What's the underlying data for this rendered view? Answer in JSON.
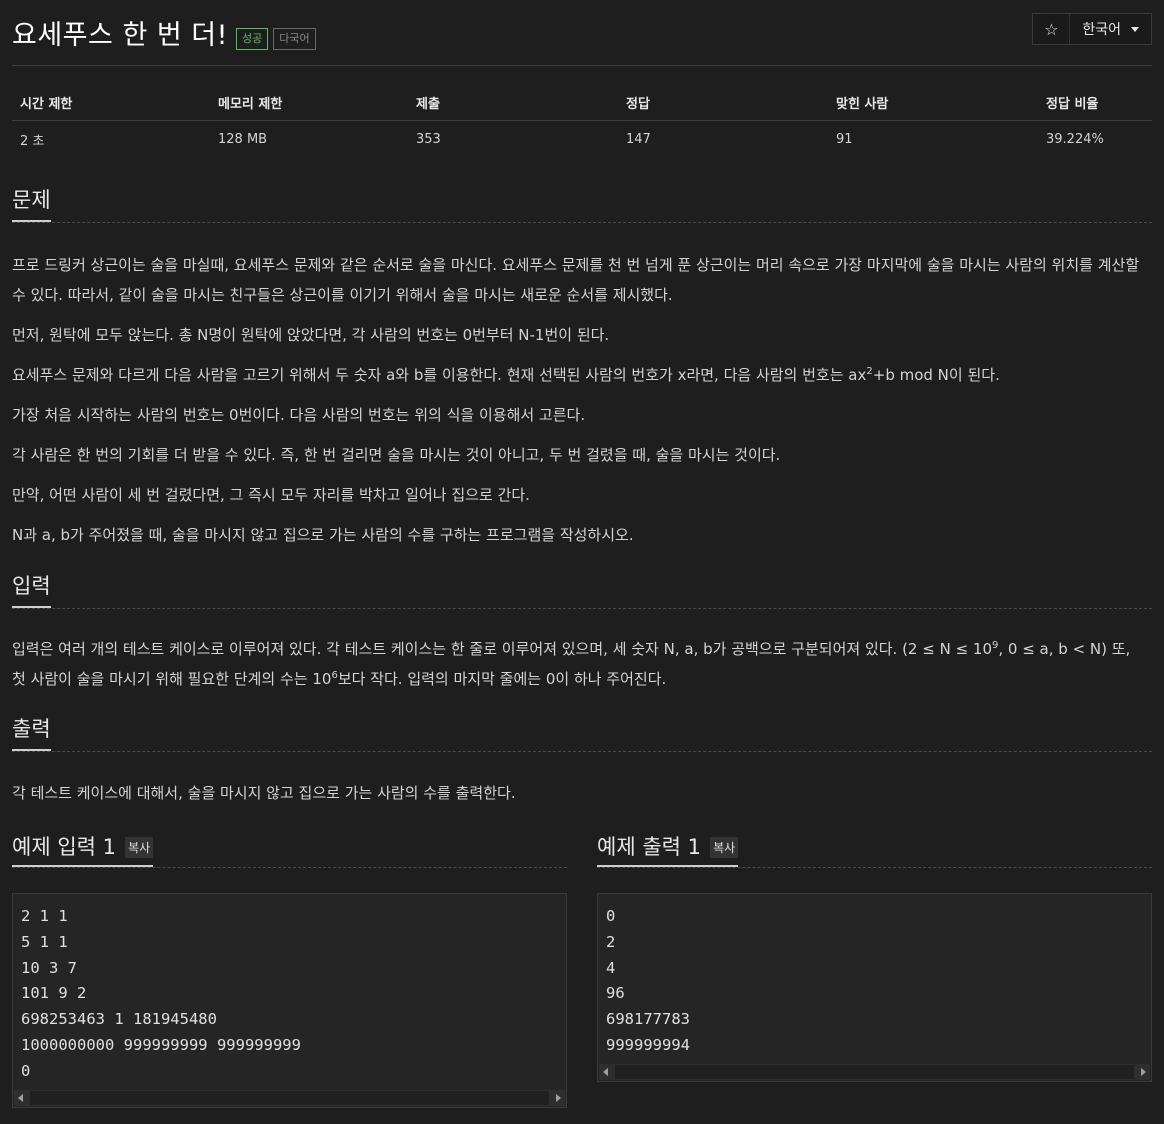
{
  "header": {
    "title": "요세푸스 한 번 더!",
    "badge_success": "성공",
    "badge_multilang": "다국어",
    "star_icon": "star-icon",
    "language": "한국어"
  },
  "info_table": {
    "headers": [
      "시간 제한",
      "메모리 제한",
      "제출",
      "정답",
      "맞힌 사람",
      "정답 비율"
    ],
    "values": [
      "2 초",
      "128 MB",
      "353",
      "147",
      "91",
      "39.224%"
    ]
  },
  "problem": {
    "heading": "문제",
    "paragraphs": [
      "프로 드링커 상근이는 술을 마실때, 요세푸스 문제와 같은 순서로 술을 마신다. 요세푸스 문제를 천 번 넘게 푼 상근이는 머리 속으로 가장 마지막에 술을 마시는 사람의 위치를 계산할 수 있다. 따라서, 같이 술을 마시는 친구들은 상근이를 이기기 위해서 술을 마시는 새로운 순서를 제시했다.",
      "먼저, 원탁에 모두 앉는다. 총 N명이 원탁에 앉았다면, 각 사람의 번호는 0번부터 N-1번이 된다.",
      "요세푸스 문제와 다르게 다음 사람을 고르기 위해서 두 숫자 a와 b를 이용한다. 현재 선택된 사람의 번호가 x라면, 다음 사람의 번호는 ax",
      "가장 처음 시작하는 사람의 번호는 0번이다. 다음 사람의 번호는 위의 식을 이용해서 고른다.",
      "각 사람은 한 번의 기회를 더 받을 수 있다. 즉, 한 번 걸리면 술을 마시는 것이 아니고, 두 번 걸렸을 때, 술을 마시는 것이다.",
      "만약, 어떤 사람이 세 번 걸렸다면, 그 즉시 모두 자리를 박차고 일어나 집으로 간다.",
      "N과 a, b가 주어졌을 때, 술을 마시지 않고 집으로 가는 사람의 수를 구하는 프로그램을 작성하시오."
    ],
    "p3_sup": "2",
    "p3_tail": "+b mod N이 된다."
  },
  "input": {
    "heading": "입력",
    "line1_a": "입력은 여러 개의 테스트 케이스로 이루어져 있다. 각 테스트 케이스는 한 줄로 이루어져 있으며, 세 숫자 N, a, b가 공백으로 구분되어져 있다. (2 ≤ N ≤ 10",
    "line1_sup": "9",
    "line1_b": ", 0 ≤ a, b < N) 또,",
    "line2_a": "첫 사람이 술을 마시기 위해 필요한 단계의 수는 10",
    "line2_sup": "6",
    "line2_b": "보다 작다. 입력의 마지막 줄에는 0이 하나 주어진다."
  },
  "output": {
    "heading": "출력",
    "text": "각 테스트 케이스에 대해서, 술을 마시지 않고 집으로 가는 사람의 수를 출력한다."
  },
  "sample_input": {
    "heading": "예제 입력 1",
    "copy": "복사",
    "lines": [
      "2 1 1",
      "5 1 1",
      "10 3 7",
      "101 9 2",
      "698253463 1 181945480",
      "1000000000 999999999 999999999",
      "0"
    ]
  },
  "sample_output": {
    "heading": "예제 출력 1",
    "copy": "복사",
    "lines": [
      "0",
      "2",
      "4",
      "96",
      "698177783",
      "999999994"
    ]
  }
}
